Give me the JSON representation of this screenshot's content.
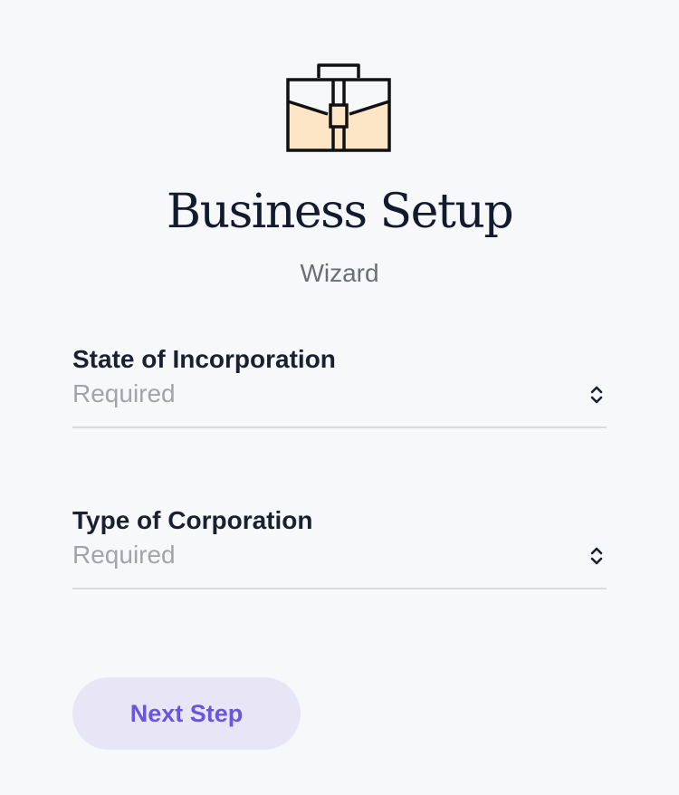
{
  "header": {
    "icon": "briefcase-icon",
    "title": "Business Setup",
    "subtitle": "Wizard"
  },
  "form": {
    "state_of_incorporation": {
      "label": "State of Incorporation",
      "placeholder": "Required",
      "icon": "chevron-up-down-icon"
    },
    "type_of_corporation": {
      "label": "Type of Corporation",
      "placeholder": "Required",
      "icon": "chevron-up-down-icon"
    }
  },
  "actions": {
    "next_label": "Next Step"
  },
  "colors": {
    "background": "#f7f8fa",
    "title": "#141a2e",
    "accent": "#6b55dc",
    "button_bg": "#e8e6f6",
    "icon_fill": "#fde6c6",
    "placeholder": "#a2a4a8"
  }
}
